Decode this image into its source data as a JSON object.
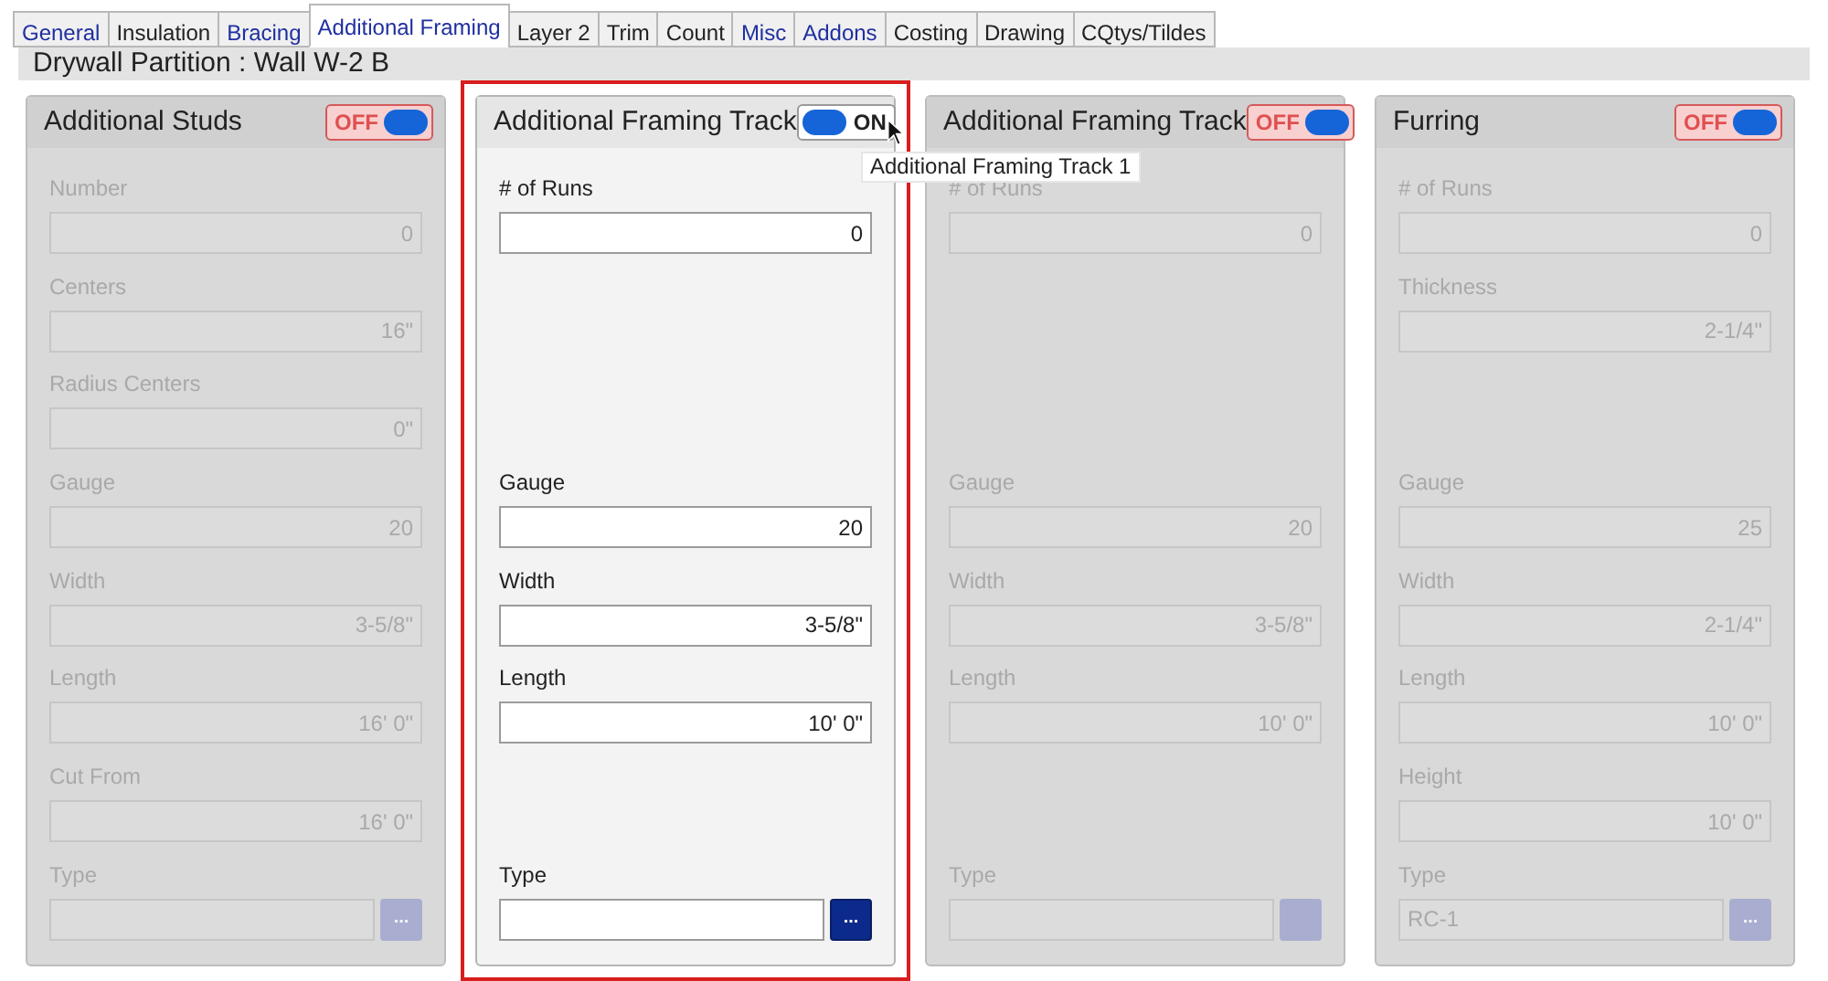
{
  "tabs": [
    {
      "label": "General",
      "selected": false,
      "color": "#1f2fa0"
    },
    {
      "label": "Insulation",
      "selected": false,
      "color": "#222222"
    },
    {
      "label": "Bracing",
      "selected": false,
      "color": "#1f2fa0"
    },
    {
      "label": "Additional Framing",
      "selected": true,
      "color": "#1f2fa0"
    },
    {
      "label": "Layer 2",
      "selected": false,
      "color": "#222222"
    },
    {
      "label": "Trim",
      "selected": false,
      "color": "#222222"
    },
    {
      "label": "Count",
      "selected": false,
      "color": "#222222"
    },
    {
      "label": "Misc",
      "selected": false,
      "color": "#1f2fa0"
    },
    {
      "label": "Addons",
      "selected": false,
      "color": "#1f2fa0"
    },
    {
      "label": "Costing",
      "selected": false,
      "color": "#222222"
    },
    {
      "label": "Drawing",
      "selected": false,
      "color": "#222222"
    },
    {
      "label": "CQtys/Tildes",
      "selected": false,
      "color": "#222222"
    }
  ],
  "title": "Drywall Partition : Wall W-2 B",
  "panels": [
    {
      "title": "Additional Studs",
      "on": false,
      "toggle_label": "OFF",
      "highlighted": false,
      "fields": [
        {
          "kind": "text",
          "label": "Number",
          "value": "0"
        },
        {
          "kind": "text",
          "label": "Centers",
          "value": "16\""
        },
        {
          "kind": "text",
          "label": "Radius Centers",
          "value": "0\""
        },
        {
          "kind": "text",
          "label": "Gauge",
          "value": "20"
        },
        {
          "kind": "text",
          "label": "Width",
          "value": "3-5/8\""
        },
        {
          "kind": "text",
          "label": "Length",
          "value": "16' 0\""
        },
        {
          "kind": "text",
          "label": "Cut From",
          "value": "16' 0\""
        },
        {
          "kind": "picker",
          "label": "Type",
          "button_label": "..."
        }
      ]
    },
    {
      "title": "Additional Framing Track",
      "on": true,
      "toggle_label": "ON",
      "highlighted": true,
      "tooltip": "Additional Framing Track 1",
      "fields": [
        {
          "kind": "text",
          "label": "# of Runs",
          "value": "0"
        },
        {
          "kind": "spacer"
        },
        {
          "kind": "spacer"
        },
        {
          "kind": "text",
          "label": "Gauge",
          "value": "20"
        },
        {
          "kind": "text",
          "label": "Width",
          "value": "3-5/8\""
        },
        {
          "kind": "text",
          "label": "Length",
          "value": "10' 0\""
        },
        {
          "kind": "spacer"
        },
        {
          "kind": "picker",
          "label": "Type",
          "button_label": "..."
        }
      ]
    },
    {
      "title": "Additional Framing Track",
      "on": false,
      "toggle_label": "OFF",
      "highlighted": false,
      "fields": [
        {
          "kind": "text",
          "label": "# of Runs",
          "value": "0"
        },
        {
          "kind": "spacer"
        },
        {
          "kind": "spacer"
        },
        {
          "kind": "text",
          "label": "Gauge",
          "value": "20"
        },
        {
          "kind": "text",
          "label": "Width",
          "value": "3-5/8\""
        },
        {
          "kind": "text",
          "label": "Length",
          "value": "10' 0\""
        },
        {
          "kind": "spacer"
        },
        {
          "kind": "picker",
          "label": "Type"
        }
      ]
    },
    {
      "title": "Furring",
      "on": false,
      "toggle_label": "OFF",
      "highlighted": false,
      "fields": [
        {
          "kind": "text",
          "label": "# of Runs",
          "value": "0"
        },
        {
          "kind": "text",
          "label": "Thickness",
          "value": "2-1/4\""
        },
        {
          "kind": "spacer"
        },
        {
          "kind": "text",
          "label": "Gauge",
          "value": "25"
        },
        {
          "kind": "text",
          "label": "Width",
          "value": "2-1/4\""
        },
        {
          "kind": "text",
          "label": "Length",
          "value": "10' 0\""
        },
        {
          "kind": "text",
          "label": "Height",
          "value": "10' 0\""
        },
        {
          "kind": "picker",
          "label": "Type",
          "value": "RC-1",
          "button_label": "..."
        }
      ]
    }
  ]
}
